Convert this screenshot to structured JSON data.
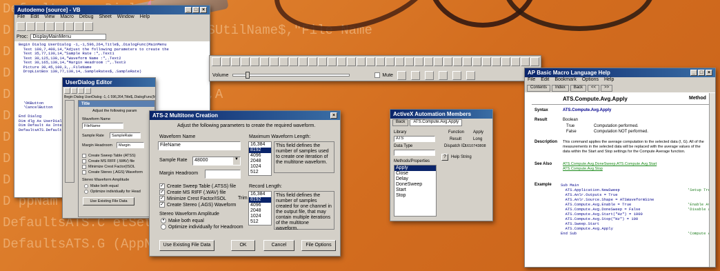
{
  "background": {
    "code_lines": [
      "Default... erDialog",
      "D           = GetSetting(AppName$,ATSUtilName$,\"File Name",
      "D                                         lName$,\"Sample",
      "D                    GetSetting(AppName$,ATSU",
      "D              th = GetSetting(AppName$,A",
      "D                          Settin",
      "D                          (AppN",
      "D                          AppNa",
      "D                          ppNam",
      "D                          ppNam",
      "DefaultsATS.C           etSetting(AppNam",
      "DefaultsATS.G           (AppName$,ATSUtil"
    ]
  },
  "editor": {
    "title": "Autodemo [source] - VB",
    "menu": [
      "File",
      "Edit",
      "View",
      "Macro",
      "Debug",
      "Sheet",
      "Window",
      "Help"
    ],
    "proc_label": "Proc:",
    "proc_value": "DisplayMainMenu",
    "lines": [
      "Begin Dialog UserDialog -1,-1,596,264,Title$,.DialogFunc(MainMenu",
      "  Text 100,7,400,14,\"Adjust the following parameters to create the",
      "  Text 35,77,130,14,\"Sample Rate :\",.Text1",
      "  Text 30,125,130,14,\"Waveform Name :\",.Text2",
      "  Text 30,165,130,14,\"Margin Headroom :\",.Text3",
      "  Picture 30,45,100,3,,.FileName",
      "  DropListBox 130,77,130,14,.SampleRates$,.SampleRate)",
      "",
      "",
      "",
      "",
      "",
      "",
      "  'OKButton",
      "  'CancelButton",
      "",
      "End Dialog",
      "Dim dlg As UserDialog",
      "Dim Default As Integer",
      "DefaultsATS.Default"
    ]
  },
  "userdialog_editor": {
    "title": "UserDialog Editor",
    "code": "Begin Dialog UserDialog -1,-1 596,264,Title$,.DialogFunc(MainMenu",
    "inner_title": "Title",
    "heading": "Adjust the following param",
    "waveform_name_label": "Waveform Name",
    "waveform_name_value": "FileName",
    "sample_rate_label": "Sample Rate",
    "sample_rate_value": "SampleRate",
    "margin_label": "Margin Headroom",
    "margin_value": "Margin",
    "checks": [
      "Create Sweep Table (ATSS)",
      "Create MS RIFF (.WAV) file",
      "Minimize Crest Factor(ISOL",
      "Create Stereo (.AGS) Waveform"
    ],
    "stereo_label": "Stereo Waveform Amplitude",
    "radios": [
      "Make both equal",
      "Optimize individually for Head"
    ],
    "use_existing": "Use Existing File Data"
  },
  "toolbar": {
    "volume_label": "Volume",
    "mute_label": "Mute",
    "icon_count": 34
  },
  "ats2": {
    "title": "ATS-2 Multitone Creation",
    "heading": "Adjust the following parameters to create the required waveform.",
    "waveform_name_label": "Waveform Name",
    "waveform_name_value": "FileName",
    "sample_rate_label": "Sample Rate",
    "sample_rate_value": "48000",
    "margin_label": "Margin Headroom",
    "margin_value": "",
    "checks": [
      {
        "label": "Create Sweep Table (.ATSS) file",
        "checked": true
      },
      {
        "label": "Create MS RIFF (.WAV) file",
        "checked": true
      },
      {
        "label": "Minimize Crest Factor/ISOL",
        "checked": true
      },
      {
        "label": "Create Stereo (.AGS) Waveform",
        "checked": true
      }
    ],
    "trim_label": "Trim",
    "stereo_label": "Stereo Waveform Amplitude",
    "radios": [
      {
        "label": "Make both equal",
        "checked": true
      },
      {
        "label": "Optimize individually for Headroom",
        "checked": false
      }
    ],
    "max_len_label": "Maximum Waveform Length:",
    "max_len_items": [
      "16,384",
      "8192",
      "4096",
      "2048",
      "1024",
      "512"
    ],
    "max_len_note": "This field defines the number of samples used to create one iteration of the multitone waveform.",
    "rec_len_label": "Record Length:",
    "rec_len_items": [
      "16,384",
      "8192",
      "4096",
      "2048",
      "1024",
      "512"
    ],
    "rec_len_note": "This field defines the number of samples created for one channel in the output file, that may contain multiple iterations of the multitone waveform.",
    "buttons": [
      "Use Existing File Data",
      "OK",
      "Cancel",
      "File Options"
    ]
  },
  "activex": {
    "title": "ActiveX Automation Members",
    "tabs": [
      "Back",
      "ATS.Compute.Avg.Apply"
    ],
    "library_label": "Library",
    "library_value": "ATS",
    "data_type_label": "Data Type",
    "data_type_value": "",
    "methods_label": "Methods/Properties",
    "methods": [
      "Apply",
      "Close",
      "Delay",
      "DoneSweep",
      "Start",
      "Stop"
    ],
    "selected_index": 0,
    "func_decl_label": "Function",
    "func_decl_value": "Apply",
    "result_label": "Result",
    "result_value": "Long",
    "dispatch_label": "Dispatch ID",
    "dispatch_value": "1610743808",
    "help_label": "Help String"
  },
  "help": {
    "title": "AP Basic Macro Language Help",
    "menu": [
      "File",
      "Edit",
      "Bookmark",
      "Options",
      "Help"
    ],
    "tabs": [
      "Contents",
      "Index",
      "Back",
      "<<",
      ">>"
    ],
    "heading": "ATS.Compute.Avg.Apply",
    "method_label": "Method",
    "syntax_label": "Syntax",
    "syntax_value": "ATS.Compute.Avg.Apply",
    "result_label": "Result",
    "result_type": "Boolean",
    "result_rows": [
      [
        "True",
        "Computation performed."
      ],
      [
        "False",
        "Computation NOT performed."
      ]
    ],
    "description_label": "Description",
    "description_value": "This command applies the average computation to the selected data (I, G). All of the measurements in the selected data will be replaced with the average values of the data within the Start and Stop settings for the Compute Average function.",
    "seealso_label": "See Also",
    "seealso_links": [
      "ATS.Compute.Avg.DoneSweep.ATS.Compute.Avg.Start",
      "ATS.Compute.Avg.Stop"
    ],
    "example_label": "Example",
    "example_lines": [
      "Sub Main",
      "  ATS.Application.NewSweep",
      "  ATS.Anlr.Outputs = True",
      "  ATS.Anlr.Source.Shape = ATSWaveformSine",
      "  ATS.Compute.Avg.Enable = True",
      "  ATS.Compute.Avg.DoneSweep = False",
      "  ATS.Compute.Avg.Start(\"Hz\") = 1000",
      "  ATS.Compute.Avg.Stop(\"Hz\") = 100",
      "  ATS.Sweep.Start",
      "  ATS.Compute.Avg.Apply",
      "End Sub"
    ],
    "right_notes": [
      "'Setup Tre",
      "",
      "",
      "'Enable Av",
      "'Disable ave",
      "",
      "",
      "",
      "",
      "'Compute Avg"
    ]
  }
}
